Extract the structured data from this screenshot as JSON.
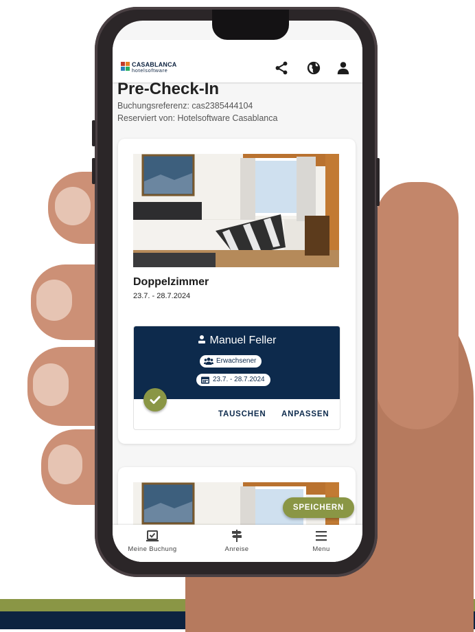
{
  "brand": {
    "name": "CASABLANCA",
    "sub": "hotelsoftware",
    "colors": {
      "navy": "#0d2a4c",
      "olive": "#8a9645",
      "red": "#c0392b",
      "orange": "#e67e22",
      "blue": "#2980b9",
      "green": "#27ae60"
    }
  },
  "header": {
    "icons": [
      "share-icon",
      "globe-icon",
      "user-icon"
    ]
  },
  "page": {
    "title": "Pre-Check-In",
    "reference": "Buchungsreferenz: cas2385444104",
    "reserved_by": "Reserviert von: Hotelsoftware Casablanca"
  },
  "room": {
    "name": "Doppelzimmer",
    "dates": "23.7. - 28.7.2024"
  },
  "guest": {
    "name": "Manuel Feller",
    "type": "Erwachsener",
    "dates": "23.7. - 28.7.2024",
    "status_icon": "check-icon",
    "actions": {
      "swap": "TAUSCHEN",
      "adjust": "ANPASSEN"
    }
  },
  "fab": {
    "label": "SPEICHERN"
  },
  "nav": [
    {
      "label": "Meine Buchung",
      "icon": "booking-icon"
    },
    {
      "label": "Anreise",
      "icon": "signpost-icon"
    },
    {
      "label": "Menu",
      "icon": "menu-icon"
    }
  ]
}
